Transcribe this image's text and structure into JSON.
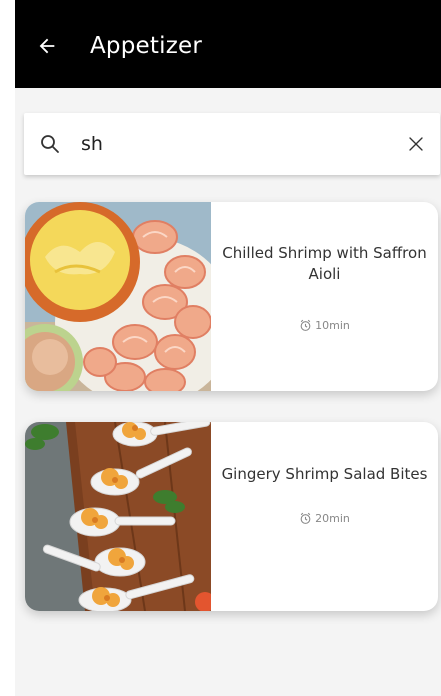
{
  "app_bar": {
    "title": "Appetizer",
    "back_icon": "arrow-left-icon",
    "background": "#000000"
  },
  "search": {
    "value": "sh",
    "search_icon": "search-icon",
    "clear_icon": "close-icon"
  },
  "recipes": [
    {
      "title": "Chilled Shrimp with Saffron Aioli",
      "time": "10min",
      "time_icon": "alarm-clock-icon"
    },
    {
      "title": "Gingery Shrimp Salad Bites",
      "time": "20min",
      "time_icon": "alarm-clock-icon"
    }
  ]
}
